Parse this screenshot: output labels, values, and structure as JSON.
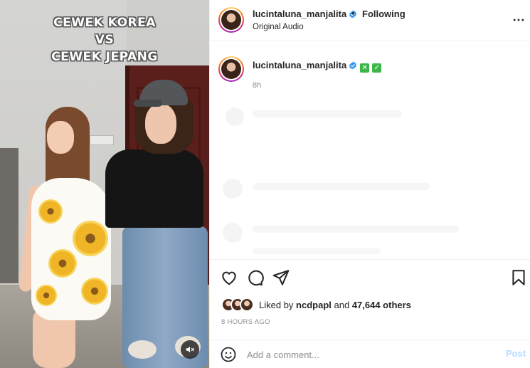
{
  "video": {
    "overlay_lines": [
      "CEWEK KOREA",
      "VS",
      "CEWEK JEPANG"
    ],
    "mute_icon": "speaker-muted-icon"
  },
  "header": {
    "username": "lucintaluna_manjalita",
    "verified": true,
    "separator": "•",
    "follow_label": "Following",
    "audio_label": "Original Audio",
    "more_icon": "more-horizontal-icon"
  },
  "caption": {
    "username": "lucintaluna_manjalita",
    "emoji_1": "✕",
    "emoji_2": "✓",
    "time": "8h"
  },
  "actions": {
    "icons": [
      "heart-icon",
      "comment-icon",
      "share-icon",
      "bookmark-icon"
    ]
  },
  "likes": {
    "prefix": "Liked by ",
    "user": "ncdpapl",
    "middle": " and ",
    "count": "47,644 others"
  },
  "posted_time": "8 HOURS AGO",
  "comment_box": {
    "placeholder": "Add a comment...",
    "post_label": "Post"
  },
  "colors": {
    "verified": "#3897f0",
    "post_disabled": "#b3dbff",
    "emoji_green": "#3db74a"
  }
}
